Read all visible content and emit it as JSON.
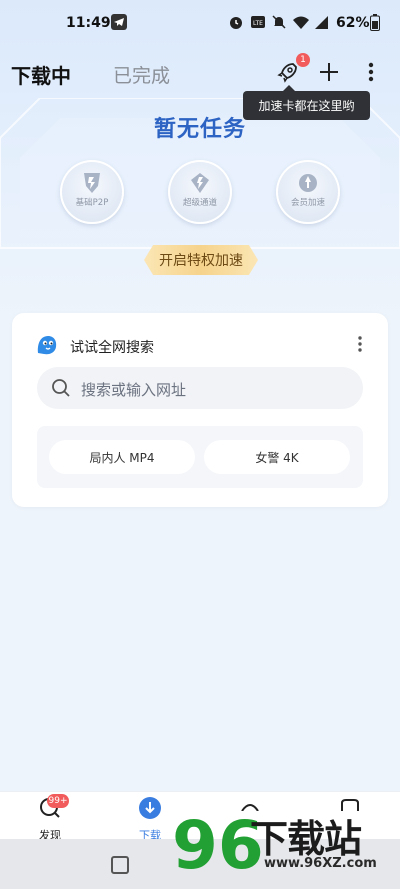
{
  "status_bar": {
    "time": "11:49",
    "battery": "62%"
  },
  "header": {
    "tab_downloading": "下载中",
    "tab_completed": "已完成",
    "notification_count": "1",
    "tooltip": "加速卡都在这里哟"
  },
  "empty_state": {
    "title": "暂无任务",
    "features": [
      {
        "label": "基础P2P",
        "icon": "p2p-icon"
      },
      {
        "label": "超级通道",
        "icon": "super-channel-icon"
      },
      {
        "label": "会员加速",
        "icon": "vip-accelerate-icon"
      }
    ],
    "vip_button": "开启特权加速"
  },
  "search_card": {
    "title": "试试全网搜索",
    "placeholder": "搜索或输入网址",
    "hot": [
      "局内人 MP4",
      "女警 4K"
    ]
  },
  "bottom_nav": {
    "items": [
      {
        "label": "发现",
        "badge": "99+"
      },
      {
        "label": "下载"
      }
    ]
  },
  "watermark": {
    "text": "下载站",
    "digits": "96",
    "url": "www.96XZ.com"
  },
  "colors": {
    "accent": "#2d64c4",
    "nav_active": "#3a7de0",
    "badge": "#f25b5b"
  }
}
